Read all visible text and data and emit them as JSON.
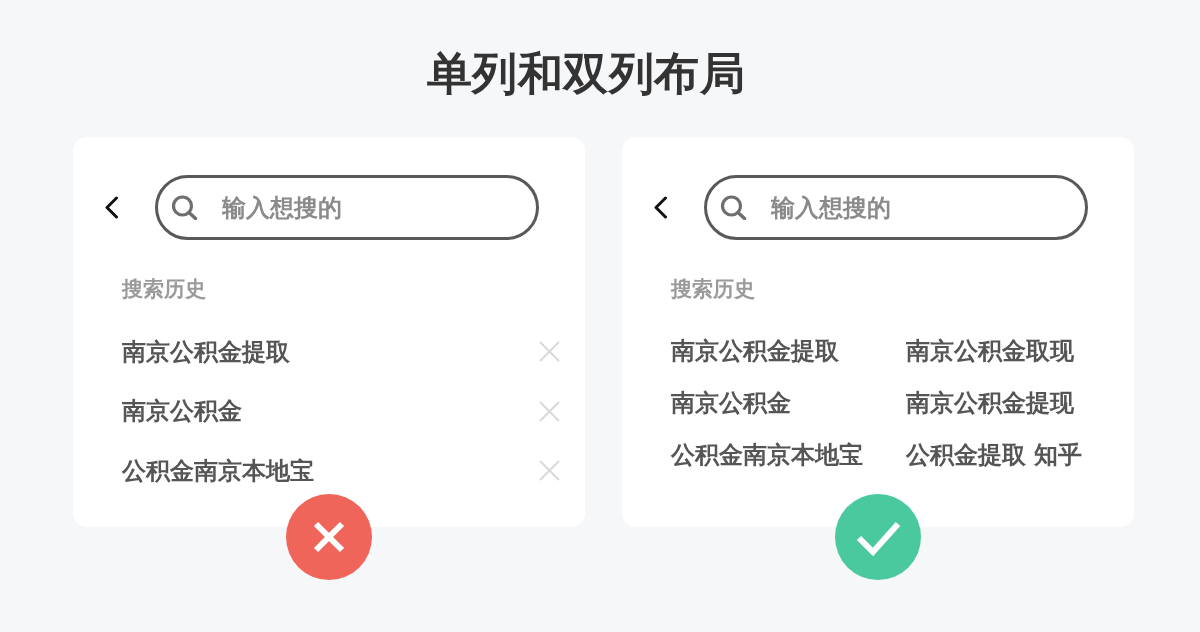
{
  "title": "单列和双列布局",
  "panels": [
    {
      "kind": "single",
      "search": {
        "placeholder": "输入想搜的"
      },
      "history_label": "搜索历史",
      "items": [
        {
          "text": "南京公积金提取",
          "removable": true
        },
        {
          "text": "南京公积金",
          "removable": true
        },
        {
          "text": "公积金南京本地宝",
          "removable": true
        }
      ],
      "verdict": {
        "kind": "cross"
      }
    },
    {
      "kind": "double",
      "search": {
        "placeholder": "输入想搜的"
      },
      "history_label": "搜索历史",
      "items": [
        {
          "text": "南京公积金提取",
          "removable": false
        },
        {
          "text": "南京公积金取现",
          "removable": false
        },
        {
          "text": "南京公积金",
          "removable": false
        },
        {
          "text": "南京公积金提现",
          "removable": false
        },
        {
          "text": "公积金南京本地宝",
          "removable": false
        },
        {
          "text": "公积金提取 知乎",
          "removable": false
        }
      ],
      "verdict": {
        "kind": "check"
      }
    }
  ]
}
